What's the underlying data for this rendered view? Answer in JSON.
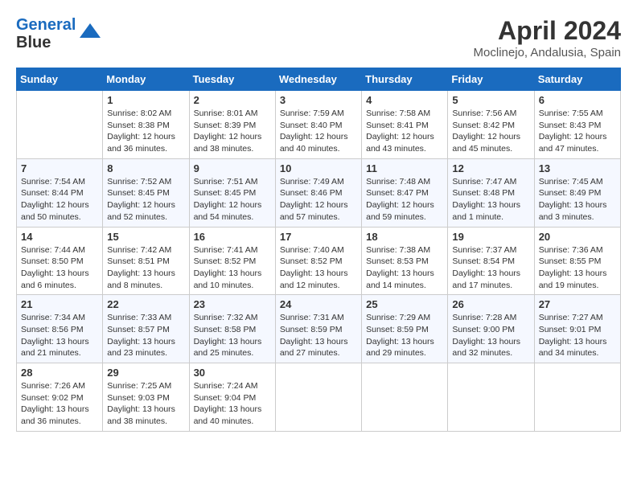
{
  "logo": {
    "line1": "General",
    "line2": "Blue"
  },
  "title": "April 2024",
  "subtitle": "Moclinejo, Andalusia, Spain",
  "header_days": [
    "Sunday",
    "Monday",
    "Tuesday",
    "Wednesday",
    "Thursday",
    "Friday",
    "Saturday"
  ],
  "weeks": [
    [
      {
        "day": "",
        "info": ""
      },
      {
        "day": "1",
        "info": "Sunrise: 8:02 AM\nSunset: 8:38 PM\nDaylight: 12 hours\nand 36 minutes."
      },
      {
        "day": "2",
        "info": "Sunrise: 8:01 AM\nSunset: 8:39 PM\nDaylight: 12 hours\nand 38 minutes."
      },
      {
        "day": "3",
        "info": "Sunrise: 7:59 AM\nSunset: 8:40 PM\nDaylight: 12 hours\nand 40 minutes."
      },
      {
        "day": "4",
        "info": "Sunrise: 7:58 AM\nSunset: 8:41 PM\nDaylight: 12 hours\nand 43 minutes."
      },
      {
        "day": "5",
        "info": "Sunrise: 7:56 AM\nSunset: 8:42 PM\nDaylight: 12 hours\nand 45 minutes."
      },
      {
        "day": "6",
        "info": "Sunrise: 7:55 AM\nSunset: 8:43 PM\nDaylight: 12 hours\nand 47 minutes."
      }
    ],
    [
      {
        "day": "7",
        "info": "Sunrise: 7:54 AM\nSunset: 8:44 PM\nDaylight: 12 hours\nand 50 minutes."
      },
      {
        "day": "8",
        "info": "Sunrise: 7:52 AM\nSunset: 8:45 PM\nDaylight: 12 hours\nand 52 minutes."
      },
      {
        "day": "9",
        "info": "Sunrise: 7:51 AM\nSunset: 8:45 PM\nDaylight: 12 hours\nand 54 minutes."
      },
      {
        "day": "10",
        "info": "Sunrise: 7:49 AM\nSunset: 8:46 PM\nDaylight: 12 hours\nand 57 minutes."
      },
      {
        "day": "11",
        "info": "Sunrise: 7:48 AM\nSunset: 8:47 PM\nDaylight: 12 hours\nand 59 minutes."
      },
      {
        "day": "12",
        "info": "Sunrise: 7:47 AM\nSunset: 8:48 PM\nDaylight: 13 hours\nand 1 minute."
      },
      {
        "day": "13",
        "info": "Sunrise: 7:45 AM\nSunset: 8:49 PM\nDaylight: 13 hours\nand 3 minutes."
      }
    ],
    [
      {
        "day": "14",
        "info": "Sunrise: 7:44 AM\nSunset: 8:50 PM\nDaylight: 13 hours\nand 6 minutes."
      },
      {
        "day": "15",
        "info": "Sunrise: 7:42 AM\nSunset: 8:51 PM\nDaylight: 13 hours\nand 8 minutes."
      },
      {
        "day": "16",
        "info": "Sunrise: 7:41 AM\nSunset: 8:52 PM\nDaylight: 13 hours\nand 10 minutes."
      },
      {
        "day": "17",
        "info": "Sunrise: 7:40 AM\nSunset: 8:52 PM\nDaylight: 13 hours\nand 12 minutes."
      },
      {
        "day": "18",
        "info": "Sunrise: 7:38 AM\nSunset: 8:53 PM\nDaylight: 13 hours\nand 14 minutes."
      },
      {
        "day": "19",
        "info": "Sunrise: 7:37 AM\nSunset: 8:54 PM\nDaylight: 13 hours\nand 17 minutes."
      },
      {
        "day": "20",
        "info": "Sunrise: 7:36 AM\nSunset: 8:55 PM\nDaylight: 13 hours\nand 19 minutes."
      }
    ],
    [
      {
        "day": "21",
        "info": "Sunrise: 7:34 AM\nSunset: 8:56 PM\nDaylight: 13 hours\nand 21 minutes."
      },
      {
        "day": "22",
        "info": "Sunrise: 7:33 AM\nSunset: 8:57 PM\nDaylight: 13 hours\nand 23 minutes."
      },
      {
        "day": "23",
        "info": "Sunrise: 7:32 AM\nSunset: 8:58 PM\nDaylight: 13 hours\nand 25 minutes."
      },
      {
        "day": "24",
        "info": "Sunrise: 7:31 AM\nSunset: 8:59 PM\nDaylight: 13 hours\nand 27 minutes."
      },
      {
        "day": "25",
        "info": "Sunrise: 7:29 AM\nSunset: 8:59 PM\nDaylight: 13 hours\nand 29 minutes."
      },
      {
        "day": "26",
        "info": "Sunrise: 7:28 AM\nSunset: 9:00 PM\nDaylight: 13 hours\nand 32 minutes."
      },
      {
        "day": "27",
        "info": "Sunrise: 7:27 AM\nSunset: 9:01 PM\nDaylight: 13 hours\nand 34 minutes."
      }
    ],
    [
      {
        "day": "28",
        "info": "Sunrise: 7:26 AM\nSunset: 9:02 PM\nDaylight: 13 hours\nand 36 minutes."
      },
      {
        "day": "29",
        "info": "Sunrise: 7:25 AM\nSunset: 9:03 PM\nDaylight: 13 hours\nand 38 minutes."
      },
      {
        "day": "30",
        "info": "Sunrise: 7:24 AM\nSunset: 9:04 PM\nDaylight: 13 hours\nand 40 minutes."
      },
      {
        "day": "",
        "info": ""
      },
      {
        "day": "",
        "info": ""
      },
      {
        "day": "",
        "info": ""
      },
      {
        "day": "",
        "info": ""
      }
    ]
  ]
}
